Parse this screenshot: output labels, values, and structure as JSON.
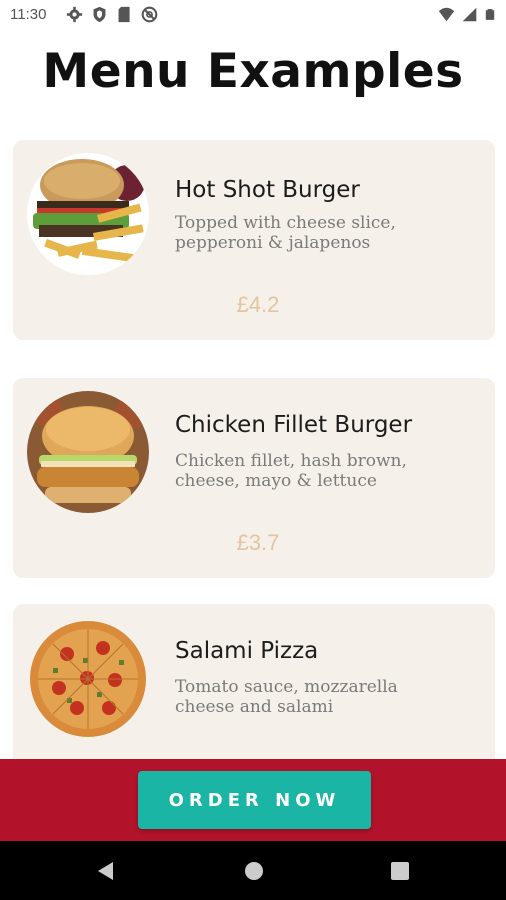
{
  "status_bar": {
    "time": "11:30",
    "icons": [
      "gear-icon",
      "shield-icon",
      "sd-card-icon",
      "no-disturb-icon"
    ],
    "right_icons": [
      "wifi-icon",
      "signal-icon",
      "battery-icon"
    ]
  },
  "page": {
    "title": "Menu Examples"
  },
  "menu": {
    "items": [
      {
        "name": "Hot Shot Burger",
        "description_line1": "Topped with cheese slice,",
        "description_line2": "pepperoni & jalapenos",
        "price": "£4.2",
        "image": "burger-fries-icon"
      },
      {
        "name": "Chicken Fillet Burger",
        "description_line1": "Chicken fillet, hash brown,",
        "description_line2": "cheese, mayo & lettuce",
        "price": "£3.7",
        "image": "chicken-burger-icon"
      },
      {
        "name": "Salami Pizza",
        "description_line1": "Tomato sauce, mozzarella",
        "description_line2": "cheese and salami",
        "image": "pizza-icon"
      }
    ]
  },
  "order": {
    "button_label": "ORDER NOW"
  },
  "colors": {
    "card_bg": "#f5f1ea",
    "price": "#e3c59d",
    "order_bar": "#b3132a",
    "order_button": "#1bb5a6"
  },
  "nav_bar": {
    "buttons": [
      "back-icon",
      "home-icon",
      "recents-icon"
    ]
  }
}
